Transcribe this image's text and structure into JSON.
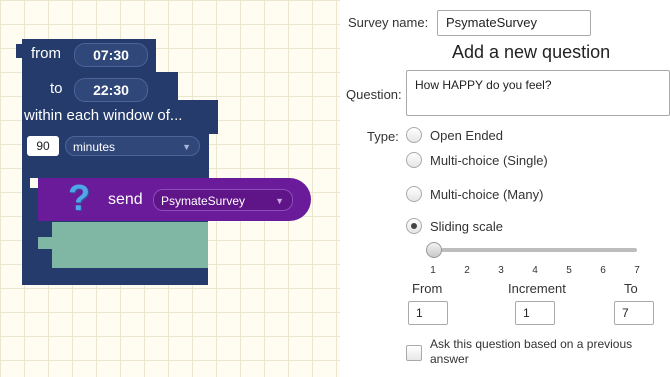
{
  "schedule_block": {
    "from_label": "from",
    "from_time": "07:30",
    "to_label": "to",
    "to_time": "22:30",
    "within_label": "within each window of...",
    "window_value": "90",
    "window_unit": "minutes"
  },
  "send_block": {
    "icon": "question-mark-icon",
    "send_label": "send",
    "survey_selected": "PsymateSurvey"
  },
  "form": {
    "survey_name_label": "Survey name:",
    "survey_name_value": "PsymateSurvey",
    "heading": "Add a new question",
    "question_label": "Question:",
    "question_value": "How HAPPY do you feel?",
    "type_label": "Type:",
    "types": [
      {
        "label": "Open Ended",
        "selected": false
      },
      {
        "label": "Multi-choice (Single)",
        "selected": false
      },
      {
        "label": "Multi-choice (Many)",
        "selected": false
      },
      {
        "label": "Sliding scale",
        "selected": true
      }
    ],
    "slider": {
      "ticks": [
        "1",
        "2",
        "3",
        "4",
        "5",
        "6",
        "7"
      ],
      "value": 1
    },
    "from_label": "From",
    "from_value": "1",
    "increment_label": "Increment",
    "increment_value": "1",
    "to_label": "To",
    "to_value": "7",
    "ask_label": "Ask this question based on a previous answer",
    "ask_checked": false
  },
  "colors": {
    "block_navy": "#243b6b",
    "block_purple": "#6a1b9a",
    "slot_teal": "#7fb6a4",
    "question_icon": "#4fa6e8"
  }
}
